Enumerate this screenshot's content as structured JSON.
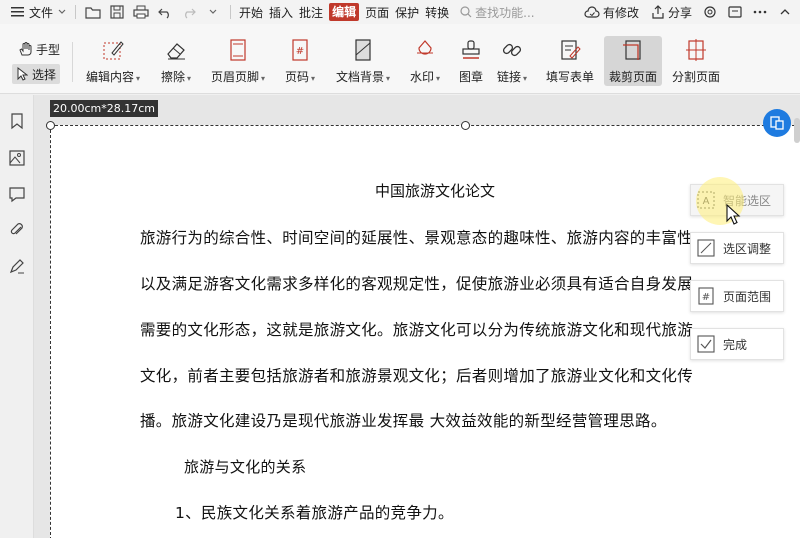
{
  "menubar": {
    "file_label": "文件",
    "tabs": [
      "开始",
      "插入",
      "批注",
      "编辑",
      "页面",
      "保护",
      "转换"
    ],
    "active_tab": "编辑",
    "search_placeholder": "查找功能...",
    "modified_label": "有修改",
    "share_label": "分享"
  },
  "ribbon": {
    "hand_label": "手型",
    "select_label": "选择",
    "tools": [
      {
        "label": "编辑内容",
        "dropdown": true
      },
      {
        "label": "擦除",
        "dropdown": true
      },
      {
        "label": "页眉页脚",
        "dropdown": true
      },
      {
        "label": "页码",
        "dropdown": true
      },
      {
        "label": "文档背景",
        "dropdown": true
      },
      {
        "label": "水印",
        "dropdown": true
      },
      {
        "label": "图章",
        "dropdown": false
      },
      {
        "label": "链接",
        "dropdown": true
      },
      {
        "label": "填写表单",
        "dropdown": false
      },
      {
        "label": "裁剪页面",
        "dropdown": false,
        "selected": true
      },
      {
        "label": "分割页面",
        "dropdown": false
      }
    ]
  },
  "canvas": {
    "dimension_label": "20.00cm*28.17cm",
    "document": {
      "title": "中国旅游文化论文",
      "lines": [
        "旅游行为的综合性、时间空间的延展性、景观意态的趣味性、旅游内容的丰富性",
        "以及满足游客文化需求多样化的客观规定性，促使旅游业必须具有适合自身发展",
        "需要的文化形态，这就是旅游文化。旅游文化可以分为传统旅游文化和现代旅游",
        "文化，前者主要包括旅游者和旅游景观文化；后者则增加了旅游业文化和文化传",
        "播。旅游文化建设乃是现代旅游业发挥最  大效益效能的新型经营管理思路。"
      ],
      "subheading": "旅游与文化的关系",
      "list_item": "1、民族文化关系着旅游产品的竞争力。"
    },
    "crop_panel": {
      "smart_select": "智能选区",
      "adjust_select": "选区调整",
      "page_range": "页面范围",
      "done": "完成"
    }
  },
  "colors": {
    "accent_red": "#c0392b",
    "accent_blue": "#1e7be0"
  }
}
